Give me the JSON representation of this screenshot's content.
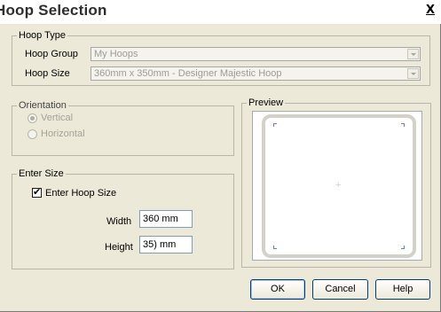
{
  "window": {
    "title": "Hoop Selection",
    "close_glyph": "X"
  },
  "hoop_type": {
    "legend": "Hoop Type",
    "group_label": "Hoop Group",
    "group_value": "My Hoops",
    "size_label": "Hoop Size",
    "size_value": "360mm x 350mm - Designer Majestic Hoop"
  },
  "orientation": {
    "legend": "Orientation",
    "options": [
      {
        "label": "Vertical",
        "checked": true
      },
      {
        "label": "Horizontal",
        "checked": false
      }
    ]
  },
  "enter_size": {
    "legend": "Enter Size",
    "checkbox_label": "Enter Hoop Size",
    "checkbox_checked": true,
    "check_glyph": "✔",
    "width_label": "Width",
    "width_value": "360 mm",
    "height_label": "Height",
    "height_value": "35) mm"
  },
  "preview": {
    "legend": "Preview",
    "crosshair_glyph": "+"
  },
  "buttons": {
    "ok": "OK",
    "cancel": "Cancel",
    "help": "Help"
  },
  "colors": {
    "corner_mark": "#6b7bd6",
    "dialog_bg": "#ece9d8"
  }
}
